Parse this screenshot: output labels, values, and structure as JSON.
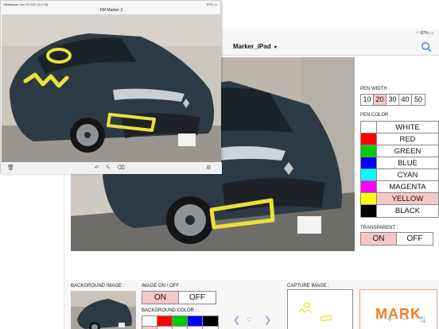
{
  "front_window": {
    "status_left": "•Wallpaper Jan 19 3:57 (4.4.03)",
    "status_right": "87%",
    "title": "FM Marker 2"
  },
  "back_window": {
    "status_right": "87%",
    "title": "Marker_iPad",
    "title_caret": "▾",
    "icons": [
      "search-icon",
      "back-icon",
      "circle-icon",
      "forward-icon",
      "plus-icon",
      "minus-icon",
      "swap-icon"
    ]
  },
  "pen_width": {
    "label": "PEN WIDTH :",
    "options": [
      "10",
      "20",
      "30",
      "40",
      "50"
    ],
    "selected": "20"
  },
  "pen_color": {
    "label": "PEN COLOR :",
    "options": [
      {
        "name": "WHITE",
        "color": "#ffffff"
      },
      {
        "name": "RED",
        "color": "#ff0000"
      },
      {
        "name": "GREEN",
        "color": "#00cc00"
      },
      {
        "name": "BLUE",
        "color": "#0000ff"
      },
      {
        "name": "CYAN",
        "color": "#00ffff"
      },
      {
        "name": "MAGENTA",
        "color": "#ff00ff"
      },
      {
        "name": "YELLOW",
        "color": "#ffff00"
      },
      {
        "name": "BLACK",
        "color": "#000000"
      }
    ],
    "selected": "YELLOW"
  },
  "transparent": {
    "label": "TRANSPARENT :",
    "on": "ON",
    "off": "OFF",
    "selected": "ON"
  },
  "background_image": {
    "label": "BACKGROUND IMAGE :"
  },
  "image_on_off": {
    "label": "IMAGE ON / OFF :",
    "on": "ON",
    "off": "OFF",
    "selected": "ON"
  },
  "background_color": {
    "label": "BACKGROUND COLOR :",
    "colors": [
      "#ffffff",
      "#ff0000",
      "#00cc00",
      "#0000ff",
      "#000000"
    ],
    "selected_index": 0
  },
  "capture_image": {
    "label": "CAPTURE IMAGE :"
  },
  "mark_button": {
    "label": "MARK"
  },
  "colors": {
    "selected_bg": "#f6c7c7",
    "marker_yellow": "#e8e23a",
    "mark_orange": "#f47c20",
    "ios_blue": "#3a7bd5"
  }
}
